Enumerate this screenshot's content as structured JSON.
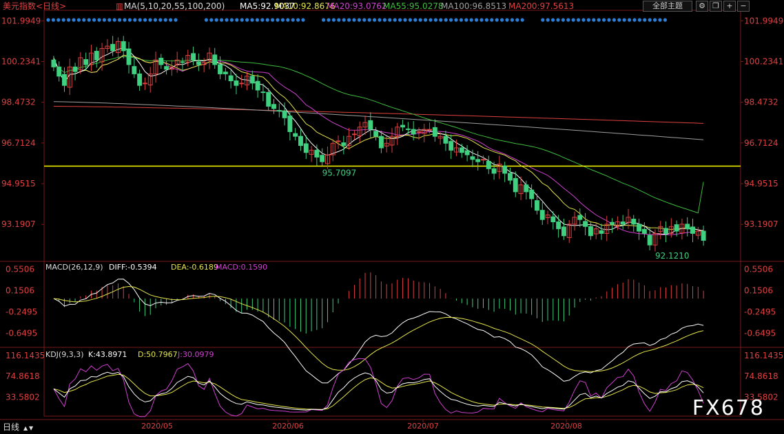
{
  "header": {
    "title": "美元指数<日线>",
    "ma_params": "MA(5,10,20,55,100,200)",
    "ma_items": [
      {
        "label": "MA5:92.9037",
        "color": "#ffffff"
      },
      {
        "label": "MA10:92.8676",
        "color": "#e6e64a"
      },
      {
        "label": "MA20:93.0762",
        "color": "#d040d0"
      },
      {
        "label": "MA55:95.0278",
        "color": "#3fbf3f"
      },
      {
        "label": "MA100:96.8513",
        "color": "#a0a0a0"
      },
      {
        "label": "MA200:97.5613",
        "color": "#e04040"
      }
    ],
    "theme_button": "全部主题",
    "icons": [
      "settings-icon",
      "restore-icon",
      "plus-icon",
      "minus-icon"
    ]
  },
  "price_axis_left": [
    "101.9949",
    "100.2341",
    "98.4732",
    "96.7124",
    "94.9515",
    "93.1907"
  ],
  "price_axis_right": [
    "101.9949",
    "100.2341",
    "98.4732",
    "96.7124",
    "94.9515",
    "93.1907"
  ],
  "annotations": [
    {
      "text": "95.7097",
      "value": 95.7097
    },
    {
      "text": "92.1210",
      "value": 92.121
    }
  ],
  "macd": {
    "label": "MACD(26,12,9)",
    "diff": "DIFF:-0.5394",
    "dea": "DEA:-0.6189",
    "macd": "MACD:0.1590",
    "axis": [
      "0.5506",
      "0.1506",
      "-0.2495",
      "-0.6495"
    ]
  },
  "kdj": {
    "label": "KDJ(9,3,3)",
    "k": "K:43.8971",
    "d": "D:50.7967",
    "j": "J:30.0979",
    "axis": [
      "116.1435",
      "74.8618",
      "33.5802"
    ]
  },
  "time_axis": {
    "period_label": "日线",
    "months": [
      "2020/05",
      "2020/06",
      "2020/07",
      "2020/08"
    ]
  },
  "watermark": "FX678",
  "colors": {
    "up": "#e04040",
    "down": "#3fd080",
    "support": "#ffff00",
    "dots": "#2d7fd6",
    "axis_text": "#e04040"
  },
  "chart_data": {
    "type": "candlestick",
    "support_level": 95.7097,
    "ylim": [
      91.8,
      102.3
    ],
    "closes": [
      100.0,
      99.6,
      99.2,
      100.0,
      99.8,
      100.4,
      100.1,
      100.6,
      100.3,
      100.8,
      100.9,
      100.7,
      101.1,
      100.7,
      100.1,
      99.7,
      99.2,
      99.3,
      99.7,
      100.3,
      100.1,
      99.9,
      100.0,
      100.3,
      100.2,
      100.5,
      100.3,
      100.1,
      100.2,
      100.6,
      100.1,
      99.7,
      99.7,
      99.4,
      99.2,
      99.3,
      99.6,
      99.3,
      99.0,
      98.9,
      98.3,
      98.2,
      98.1,
      97.8,
      97.2,
      97.0,
      96.6,
      96.3,
      96.4,
      96.1,
      95.9,
      96.2,
      96.7,
      96.8,
      96.6,
      97.0,
      97.1,
      97.4,
      97.6,
      97.3,
      97.0,
      96.5,
      96.7,
      97.0,
      97.4,
      97.4,
      97.3,
      97.1,
      97.2,
      97.3,
      97.3,
      97.0,
      97.0,
      96.7,
      96.4,
      96.5,
      96.3,
      96.2,
      96.0,
      95.9,
      96.0,
      95.6,
      95.4,
      95.8,
      95.4,
      95.1,
      94.6,
      94.9,
      94.6,
      94.3,
      93.8,
      93.4,
      93.6,
      93.3,
      93.0,
      92.7,
      93.2,
      93.5,
      93.4,
      93.1,
      92.7,
      93.0,
      92.8,
      93.2,
      93.2,
      93.3,
      93.2,
      93.5,
      93.2,
      92.9,
      92.8,
      92.3,
      92.8,
      93.1,
      92.8,
      93.1,
      92.9,
      93.2,
      93.0,
      92.8,
      92.9,
      92.5
    ],
    "ma5": [
      100.4,
      99.82,
      99.34,
      99.68,
      99.7,
      99.8,
      99.9,
      100.18,
      100.24,
      100.44,
      100.54,
      100.66,
      100.76,
      100.84,
      100.7,
      100.46,
      100.16,
      99.8,
      99.6,
      99.64,
      99.72,
      99.86,
      99.96,
      100.12,
      100.1,
      100.18,
      100.26,
      100.28,
      100.26,
      100.34,
      100.26,
      100.14,
      100.06,
      99.9,
      99.62,
      99.46,
      99.44,
      99.36,
      99.28,
      99.22,
      99.02,
      98.74,
      98.5,
      98.26,
      97.92,
      97.66,
      97.34,
      96.98,
      96.7,
      96.48,
      96.26,
      96.18,
      96.26,
      96.34,
      96.44,
      96.66,
      96.84,
      96.98,
      97.14,
      97.28,
      97.28,
      97.16,
      97.02,
      96.9,
      96.92,
      97.0,
      97.16,
      97.24,
      97.28,
      97.26,
      97.24,
      97.18,
      97.12,
      97.06,
      96.88,
      96.72,
      96.58,
      96.42,
      96.28,
      96.18,
      96.08,
      95.94,
      95.78,
      95.74,
      95.64,
      95.46,
      95.38,
      95.16,
      94.9,
      94.7,
      94.44,
      94.2,
      93.92,
      93.68,
      93.42,
      93.2,
      93.16,
      93.14,
      93.16,
      93.18,
      93.18,
      93.14,
      93.0,
      92.96,
      92.98,
      93.1,
      93.14,
      93.28,
      93.28,
      93.22,
      93.12,
      92.94,
      92.8,
      92.78,
      92.76,
      92.82,
      92.94,
      93.02,
      93.0,
      93.0,
      92.96,
      92.88
    ],
    "ma10": [
      100.4,
      99.82,
      99.34,
      99.68,
      99.7,
      99.8,
      99.86,
      99.76,
      99.79,
      100.07,
      100.12,
      100.23,
      100.33,
      100.51,
      100.47,
      100.45,
      100.36,
      100.23,
      100.18,
      100.24,
      100.21,
      100.16,
      100.06,
      99.96,
      99.85,
      99.91,
      99.99,
      100.07,
      100.11,
      100.22,
      100.18,
      100.16,
      100.17,
      100.08,
      99.94,
      99.79,
      99.73,
      99.64,
      99.61,
      99.56,
      99.34,
      99.06,
      98.85,
      98.68,
      98.43,
      98.14,
      97.83,
      97.54,
      97.4,
      97.18,
      97.06,
      96.95,
      96.83,
      96.68,
      96.54,
      96.47,
      96.6,
      96.72,
      96.84,
      96.92,
      96.99,
      96.94,
      96.91,
      96.91,
      96.98,
      97.04,
      97.05,
      96.96,
      96.92,
      97.03,
      97.06,
      97.12,
      97.11,
      97.08,
      97.02,
      97.04,
      96.98,
      96.91,
      96.79,
      96.65,
      96.51,
      96.42,
      96.33,
      96.26,
      96.19,
      96.05,
      95.94,
      95.73,
      95.6,
      95.45,
      95.22,
      94.97,
      94.84,
      94.58,
      94.36,
      94.1,
      93.91,
      93.84,
      93.65,
      93.42,
      93.3,
      93.26,
      93.16,
      93.15,
      93.17,
      93.15,
      93.15,
      93.15,
      93.13,
      93.11,
      93.12,
      93.04,
      93.04,
      93.03,
      93.0,
      92.97,
      93.01,
      93.02,
      93.05,
      93.01,
      92.96,
      92.91
    ],
    "ma20": [
      100.4,
      99.82,
      99.34,
      99.68,
      99.7,
      99.8,
      99.86,
      99.76,
      99.79,
      100.07,
      100.12,
      100.23,
      100.33,
      100.51,
      100.47,
      100.45,
      100.36,
      100.23,
      100.18,
      100.24,
      100.3,
      100.11,
      99.95,
      99.9,
      99.81,
      99.91,
      99.99,
      100.07,
      100.11,
      100.22,
      100.23,
      100.25,
      100.2,
      100.12,
      100.0,
      99.9,
      99.82,
      99.79,
      99.78,
      99.77,
      99.73,
      99.5,
      99.3,
      99.13,
      98.99,
      98.84,
      98.61,
      98.36,
      98.22,
      98.04,
      97.88,
      97.73,
      97.59,
      97.48,
      97.37,
      97.27,
      97.26,
      97.27,
      97.29,
      97.3,
      97.26,
      97.2,
      97.16,
      97.12,
      97.06,
      97.06,
      97.08,
      97.09,
      97.13,
      97.18,
      97.2,
      97.22,
      97.21,
      97.19,
      97.15,
      97.11,
      97.05,
      96.97,
      96.88,
      96.79,
      96.66,
      96.51,
      96.4,
      96.32,
      96.23,
      96.12,
      96.01,
      95.89,
      95.77,
      95.63,
      95.52,
      95.42,
      95.31,
      95.14,
      94.95,
      94.75,
      94.57,
      94.38,
      94.15,
      93.95,
      93.77,
      93.6,
      93.47,
      93.35,
      93.2,
      93.05,
      92.94,
      92.87,
      92.83,
      92.79,
      92.78,
      92.75,
      92.75,
      92.75,
      92.74,
      92.74,
      92.77,
      92.8,
      92.84,
      92.87,
      92.91,
      92.95
    ],
    "ma55_label": "MA55:95.0278",
    "ma100_label": "MA100:96.8513",
    "ma200_label": "MA200:97.5613",
    "ma55_end": 95.03,
    "ma100_end": 96.85,
    "ma200_end": 97.56,
    "macd_ylim": [
      -0.85,
      0.62
    ],
    "macd_diff_end": -0.5394,
    "macd_dea_end": -0.6189,
    "macd_hist_end": 0.159,
    "kdj_ylim": [
      0,
      124
    ],
    "kdj_k_end": 43.8971,
    "kdj_d_end": 50.7967,
    "kdj_j_end": 30.0979
  }
}
